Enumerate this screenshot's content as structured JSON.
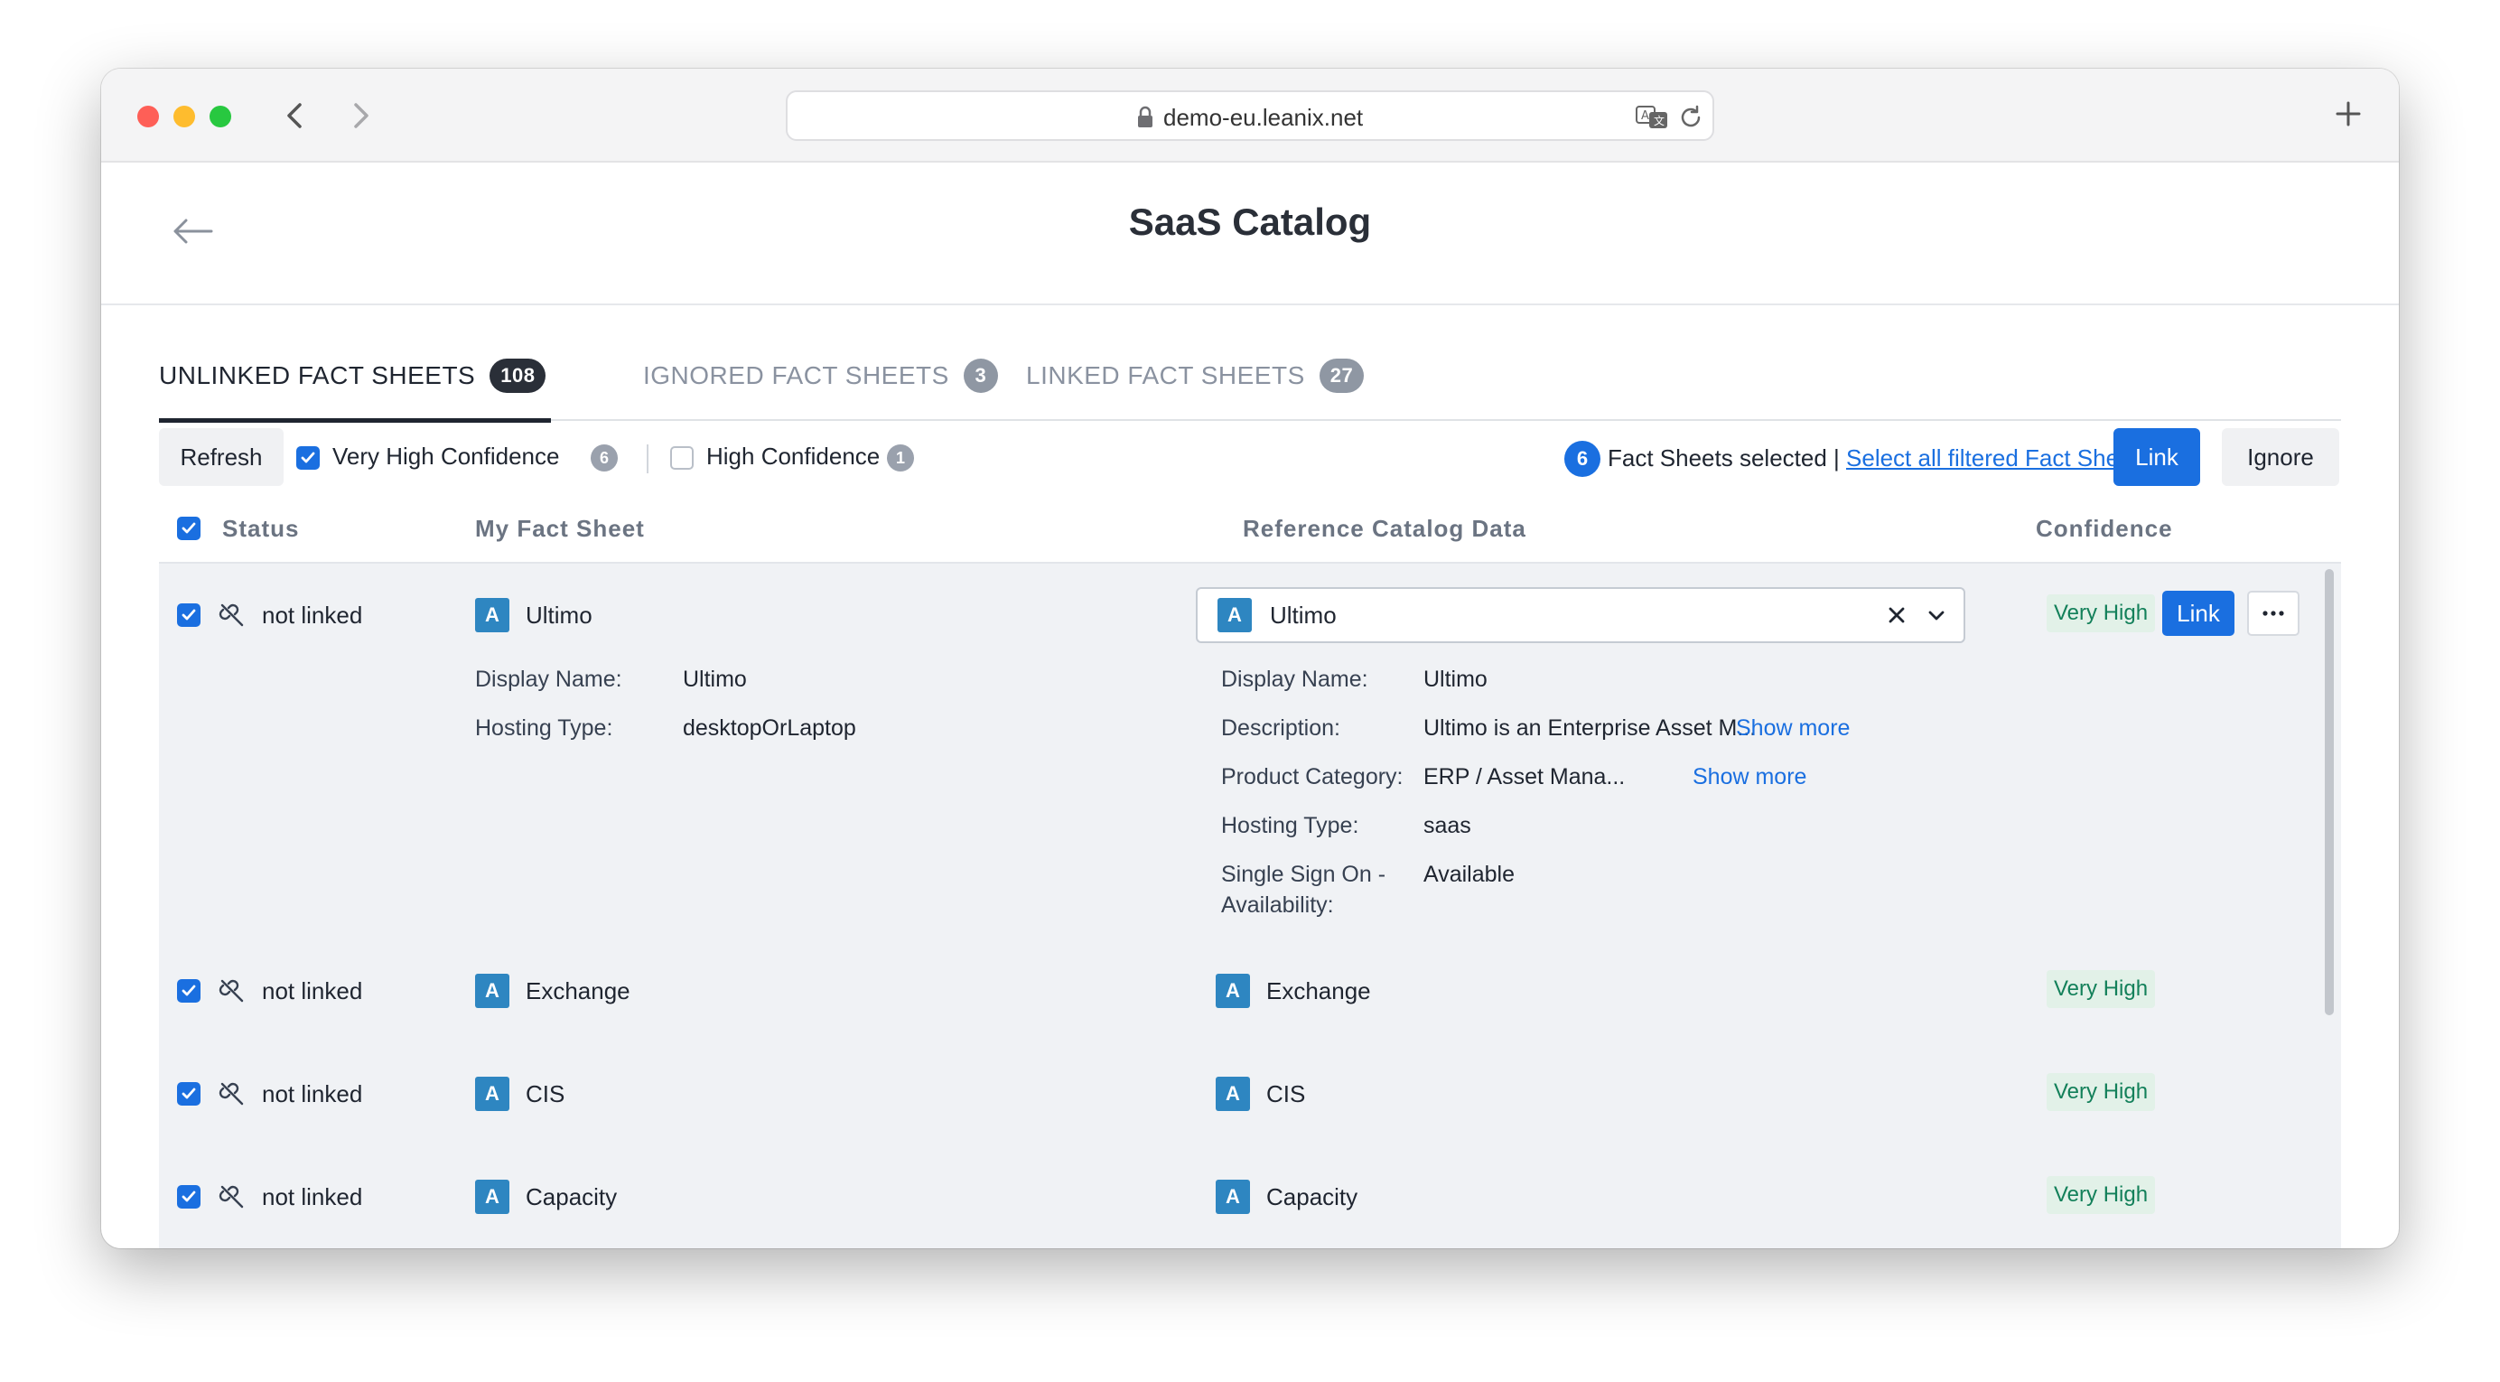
{
  "browser": {
    "url": "demo-eu.leanix.net"
  },
  "page": {
    "title": "SaaS Catalog"
  },
  "tabs": [
    {
      "label": "UNLINKED FACT SHEETS",
      "count": "108",
      "active": true
    },
    {
      "label": "IGNORED FACT SHEETS",
      "count": "3",
      "active": false
    },
    {
      "label": "LINKED FACT SHEETS",
      "count": "27",
      "active": false
    }
  ],
  "filters": {
    "refresh_label": "Refresh",
    "very_high_label": "Very High Confidence",
    "very_high_count": "6",
    "very_high_checked": true,
    "high_label": "High Confidence",
    "high_count": "1",
    "high_checked": false,
    "selected_count": "6",
    "selected_text": "Fact Sheets selected |",
    "select_all_label": "Select all filtered Fact Sheets",
    "link_label": "Link",
    "ignore_label": "Ignore"
  },
  "table": {
    "columns": {
      "status": "Status",
      "my_fact_sheet": "My Fact Sheet",
      "reference": "Reference Catalog Data",
      "confidence": "Confidence"
    },
    "expanded_row": {
      "status": "not linked",
      "type_letter": "A",
      "name": "Ultimo",
      "my_details": [
        {
          "label": "Display Name:",
          "value": "Ultimo"
        },
        {
          "label": "Hosting Type:",
          "value": "desktopOrLaptop"
        }
      ],
      "catalog_selection": "Ultimo",
      "catalog_details": [
        {
          "label": "Display Name:",
          "value": "Ultimo",
          "show_more": ""
        },
        {
          "label": "Description:",
          "value": "Ultimo is an Enterprise Asset M...",
          "show_more": "Show more"
        },
        {
          "label": "Product Category:",
          "value": "ERP / Asset Mana...",
          "show_more": "Show more"
        },
        {
          "label": "Hosting Type:",
          "value": "saas",
          "show_more": ""
        },
        {
          "label": "Single Sign On -",
          "label2": "Availability:",
          "value": "Available",
          "show_more": ""
        }
      ],
      "confidence": "Very High",
      "link_label": "Link",
      "more_label": "···"
    },
    "rows": [
      {
        "status": "not linked",
        "type_letter": "A",
        "name": "Exchange",
        "catalog": "Exchange",
        "confidence": "Very High"
      },
      {
        "status": "not linked",
        "type_letter": "A",
        "name": "CIS",
        "catalog": "CIS",
        "confidence": "Very High"
      },
      {
        "status": "not linked",
        "type_letter": "A",
        "name": "Capacity",
        "catalog": "Capacity",
        "confidence": "Very High"
      }
    ]
  },
  "colors": {
    "primary": "#1a6fe0",
    "badge_app": "#2e86c1",
    "confidence_bg": "#e2f1e8",
    "confidence_text": "#13805a"
  }
}
